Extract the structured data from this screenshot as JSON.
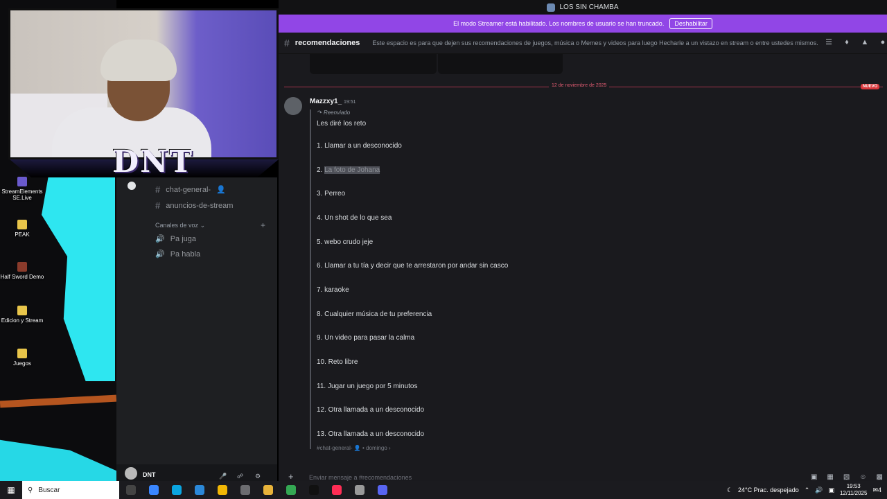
{
  "window_title": "LOS SIN CHAMBA",
  "streamer_mode": {
    "message": "El modo Streamer está habilitado. Los nombres de usuario se han truncado.",
    "disable_label": "Deshabilitar"
  },
  "channel": {
    "name": "recomendaciones",
    "topic": "Este espacio es para que dejen sus recomendaciones de juegos, música o Memes y videos para luego Hecharle a un vistazo en stream o entre ustedes mismos."
  },
  "sidebar": {
    "text_channels": [
      "chat-general-",
      "anuncios-de-stream"
    ],
    "voice_category": "Canales de voz",
    "voice_channels": [
      "Pa juga",
      "Pa habla"
    ]
  },
  "desktop_icons": [
    {
      "label": "StreamElements SE.Live",
      "color": "#6a5acd"
    },
    {
      "label": "PEAK",
      "color": "#e8c54a"
    },
    {
      "label": "Half Sword Demo",
      "color": "#8a3b2b"
    },
    {
      "label": "Edicion y Stream",
      "color": "#e8c54a"
    },
    {
      "label": "Juegos",
      "color": "#e8c54a"
    }
  ],
  "webcam_brand": "DNT",
  "divider": {
    "date": "12 de noviembre de 2025",
    "badge": "NUEVO"
  },
  "message": {
    "author": "Mazzxy1_",
    "time": "19:51",
    "forwarded_label": "Reenviado",
    "intro": "Les diré los reto",
    "items": [
      "1. Llamar a un desconocido",
      "La foto de Johana",
      "3. Perreo",
      "4. Un shot de lo que sea",
      "5. webo crudo jeje",
      "6. Llamar a tu tía y decir que te arrestaron por andar sin casco",
      "7. karaoke",
      "8. Cualquier música de tu preferencia",
      "9. Un video para pasar la calma",
      "10. Reto libre",
      "11. Jugar un juego por 5 minutos",
      "12. Otra llamada a un desconocido",
      "13. Otra llamada a un desconocido"
    ],
    "item2_prefix": "2. ",
    "source_channel": "#chat-general-",
    "source_day": "domingo"
  },
  "user": {
    "name": "DNT"
  },
  "composer_placeholder": "Enviar mensaje a #recomendaciones",
  "taskbar": {
    "search_label": "Buscar",
    "weather": "24°C  Prac. despejado",
    "time": "19:53",
    "date": "12/11/2025",
    "notification_count": "4",
    "apps": [
      "#3a86ff",
      "#0aa5e0",
      "#2b88d8",
      "#f2b705",
      "#6c6c70",
      "#e8b33a",
      "#34a853",
      "#111111",
      "#ff2d55",
      "#999999",
      "#5865f2"
    ]
  },
  "colors": {
    "accent": "#9146e6",
    "new_divider": "#da373c"
  }
}
